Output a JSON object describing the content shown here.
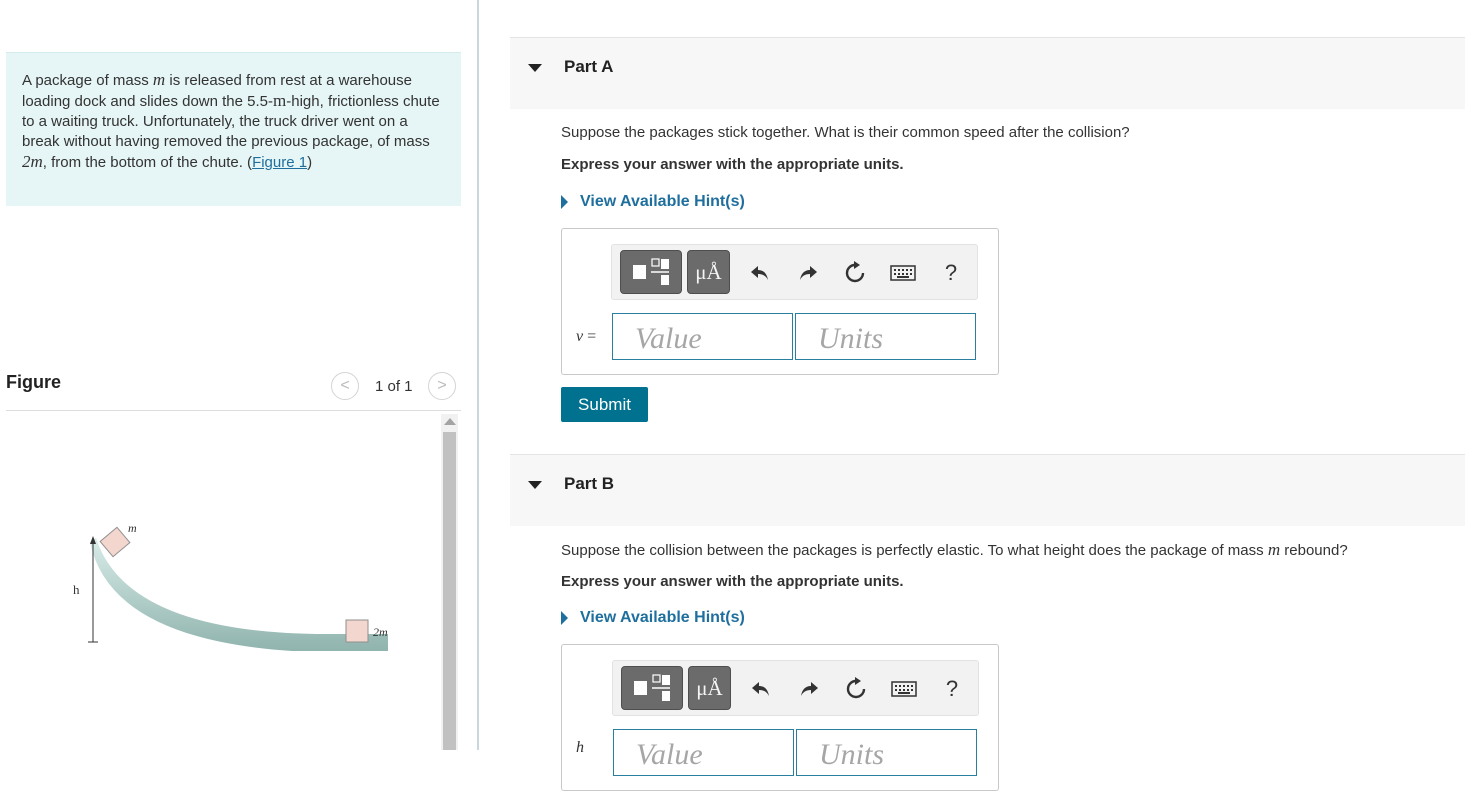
{
  "problem": {
    "text_1": "A package of mass ",
    "mass_sym": "m",
    "text_2": " is released from rest at a warehouse loading dock and slides down the 5.5-",
    "unit_sym": "m",
    "text_3": "-high, frictionless chute to a waiting truck. Unfortunately, the truck driver went on a break without having removed the previous package, of mass ",
    "mass2_sym": "2m",
    "text_4": ", from the bottom of the chute. (",
    "figure_link": "Figure 1",
    "text_5": ")"
  },
  "figure": {
    "title": "Figure",
    "count": "1 of 1",
    "prev_glyph": "<",
    "next_glyph": ">",
    "label_m": "m",
    "label_h": "h",
    "label_2m": "2m"
  },
  "part_a": {
    "title": "Part A",
    "question": "Suppose the packages stick together. What is their common speed after the collision?",
    "instruction": "Express your answer with the appropriate units.",
    "hint": "View Available Hint(s)",
    "variable": "v",
    "equals": " =",
    "value_placeholder": "Value",
    "units_placeholder": "Units",
    "submit": "Submit"
  },
  "part_b": {
    "title": "Part B",
    "question_1": "Suppose the collision between the packages is perfectly elastic. To what height does the package of mass ",
    "mass_sym": "m",
    "question_2": " rebound?",
    "instruction": "Express your answer with the appropriate units.",
    "hint": "View Available Hint(s)",
    "variable": "h",
    "value_placeholder": "Value",
    "units_placeholder": "Units"
  },
  "toolbar": {
    "unit_button": "μÅ",
    "help": "?",
    "icons": [
      "templates-icon",
      "units-icon",
      "undo-icon",
      "redo-icon",
      "reset-icon",
      "keyboard-icon",
      "help-icon"
    ]
  },
  "colors": {
    "accent": "#00728f",
    "link": "#1f6f9e",
    "problem_bg": "#e6f5f5",
    "part_header_bg": "#f7f7f7"
  }
}
